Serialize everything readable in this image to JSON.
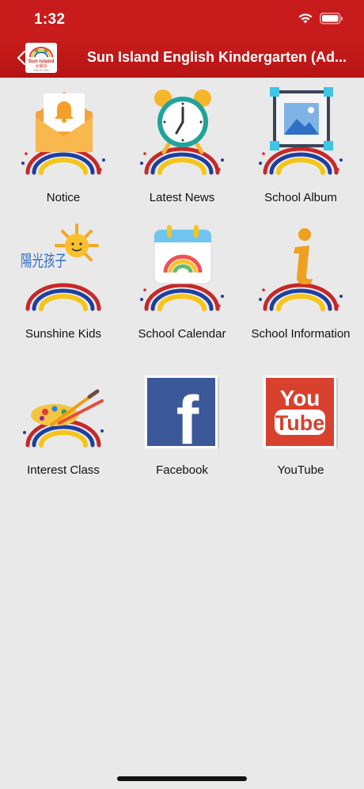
{
  "status": {
    "time": "1:32"
  },
  "nav": {
    "title": "Sun Island English Kindergarten (Ad...",
    "logo_text": "Sun Island",
    "logo_sub": "太陽島",
    "logo_since": "SINCE 1994"
  },
  "tiles": [
    {
      "label": "Notice",
      "icon": "envelope-bell-icon"
    },
    {
      "label": "Latest News",
      "icon": "alarm-clock-icon"
    },
    {
      "label": "School Album",
      "icon": "photo-frame-icon"
    },
    {
      "label": "Sunshine Kids",
      "icon": "sunshine-kids-icon",
      "icon_text": "陽光孩子"
    },
    {
      "label": "School Calendar",
      "icon": "calendar-rainbow-icon"
    },
    {
      "label": "School Information",
      "icon": "info-icon"
    },
    {
      "label": "Interest Class",
      "icon": "paint-palette-icon"
    },
    {
      "label": "Facebook",
      "icon": "facebook-icon",
      "icon_text": "f"
    },
    {
      "label": "YouTube",
      "icon": "youtube-icon",
      "icon_text_top": "You",
      "icon_text_bottom": "Tube"
    }
  ],
  "colors": {
    "header": "#c81c1c",
    "background": "#e9e9e9",
    "facebook": "#3b5998",
    "youtube": "#d9412f"
  }
}
